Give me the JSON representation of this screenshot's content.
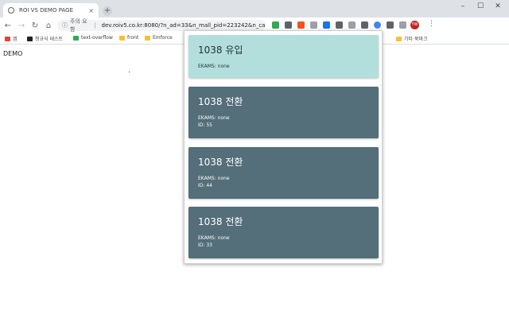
{
  "browser": {
    "tab_title": "ROI VS DEMO PAGE",
    "tab_close": "×",
    "new_tab": "+",
    "window_controls": [
      "–",
      "☐",
      "✕"
    ],
    "omnibox": {
      "security_label": "주의 요함",
      "url": "dev.roiv5.co.kr:8080/?n_ad=33&n_mall_pid=223242&n_ca..."
    },
    "profile_initials": "YW",
    "bookmarks": [
      {
        "label": "앱",
        "color": "#ea4335"
      },
      {
        "label": "청규식 테스트",
        "color": "#202124"
      },
      {
        "label": "text-overflow",
        "color": "#34a853"
      },
      {
        "label": "front",
        "color": "#fbc02d"
      },
      {
        "label": "Emforce",
        "color": "#fbc02d"
      }
    ],
    "other_bookmarks": "기타 북마크"
  },
  "page": {
    "demo_text": "DEMO"
  },
  "popup": {
    "cards": [
      {
        "title": "1038 유입",
        "ekams": "EKAMS: none",
        "id": ""
      },
      {
        "title": "1038 전환",
        "ekams": "EKAMS: none",
        "id": "ID: 55"
      },
      {
        "title": "1038 전환",
        "ekams": "EKAMS: none",
        "id": "ID: 44"
      },
      {
        "title": "1038 전환",
        "ekams": "EKAMS: none",
        "id": "ID: 33"
      }
    ]
  },
  "colors": {
    "inflow_card": "#b2dfdb",
    "convert_card": "#546e7a",
    "tabstrip": "#dee1e6"
  }
}
